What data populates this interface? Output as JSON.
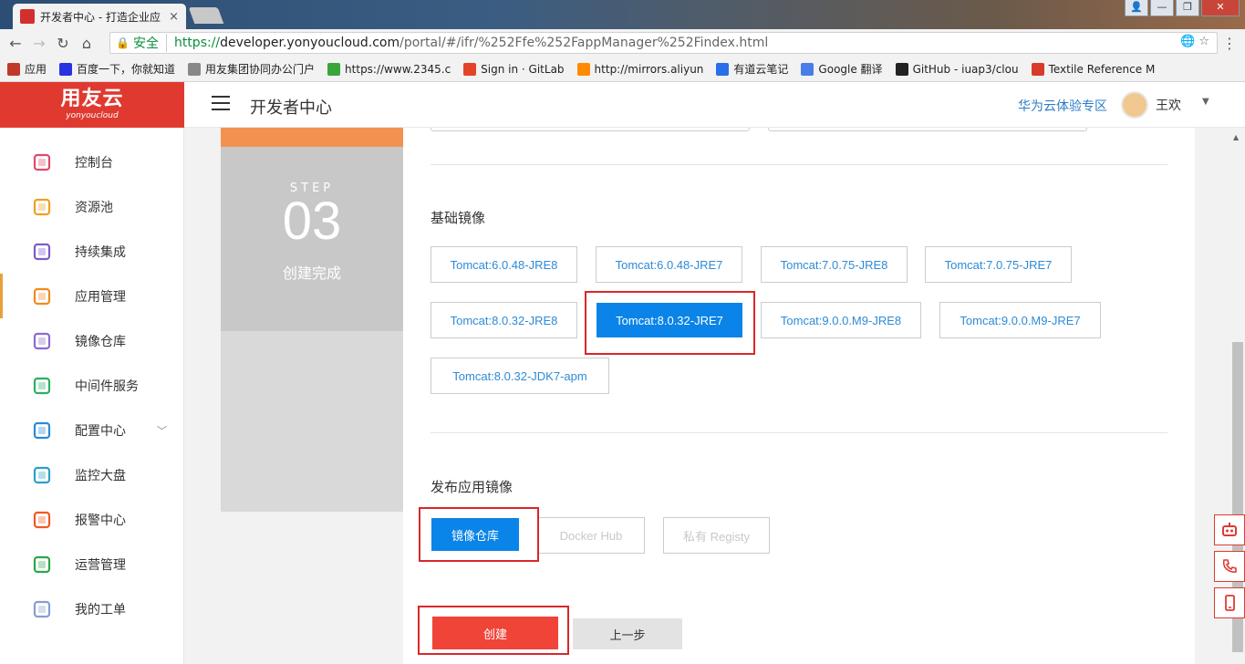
{
  "browser": {
    "tab_title": "开发者中心 - 打造企业应",
    "tab_close": "×",
    "secure_label": "安全",
    "url_scheme": "https://",
    "url_host": "developer.yonyoucloud.com",
    "url_path": "/portal/#/ifr/%252Ffe%252FappManager%252Findex.html",
    "bookmarks": [
      {
        "label": "应用",
        "color": "#c0392b"
      },
      {
        "label": "百度一下，你就知道",
        "color": "#2932e1"
      },
      {
        "label": "用友集团协同办公门户",
        "color": "#888888"
      },
      {
        "label": "https://www.2345.c",
        "color": "#3aa53a"
      },
      {
        "label": "Sign in · GitLab",
        "color": "#e24329"
      },
      {
        "label": "http://mirrors.aliyun",
        "color": "#ff8a00"
      },
      {
        "label": "有道云笔记",
        "color": "#2a6ee8"
      },
      {
        "label": "Google 翻译",
        "color": "#4a7de8"
      },
      {
        "label": "GitHub - iuap3/clou",
        "color": "#222222"
      },
      {
        "label": "Textile Reference M",
        "color": "#d83b2b"
      }
    ]
  },
  "header": {
    "logo_main": "用友云",
    "logo_sub": "yonyoucloud",
    "title": "开发者中心",
    "huawei_link": "华为云体验专区",
    "user_name": "王欢"
  },
  "sidebar": {
    "items": [
      {
        "label": "控制台",
        "icon": "dashboard-icon",
        "color": "#e04a6a"
      },
      {
        "label": "资源池",
        "icon": "inbox-icon",
        "color": "#f0a020"
      },
      {
        "label": "持续集成",
        "icon": "integration-icon",
        "color": "#7a5cc8"
      },
      {
        "label": "应用管理",
        "icon": "cubes-icon",
        "color": "#f08a20"
      },
      {
        "label": "镜像仓库",
        "icon": "warehouse-icon",
        "color": "#8a6ad0"
      },
      {
        "label": "中间件服务",
        "icon": "database-icon",
        "color": "#28b060"
      },
      {
        "label": "配置中心",
        "icon": "tools-icon",
        "color": "#2a8ad8"
      },
      {
        "label": "监控大盘",
        "icon": "monitor-icon",
        "color": "#2aa0c8"
      },
      {
        "label": "报警中心",
        "icon": "bell-icon",
        "color": "#f05a20"
      },
      {
        "label": "运营管理",
        "icon": "chart-board-icon",
        "color": "#28a848"
      },
      {
        "label": "我的工单",
        "icon": "document-icon",
        "color": "#8a9ad8"
      }
    ]
  },
  "step": {
    "label": "STEP",
    "number": "03",
    "text": "创建完成"
  },
  "base_image": {
    "title": "基础镜像",
    "options": [
      "Tomcat:6.0.48-JRE8",
      "Tomcat:6.0.48-JRE7",
      "Tomcat:7.0.75-JRE8",
      "Tomcat:7.0.75-JRE7",
      "Tomcat:8.0.32-JRE8",
      "Tomcat:8.0.32-JRE7",
      "Tomcat:9.0.0.M9-JRE8",
      "Tomcat:9.0.0.M9-JRE7",
      "Tomcat:8.0.32-JDK7-apm"
    ],
    "selected": "Tomcat:8.0.32-JRE7"
  },
  "publish": {
    "title": "发布应用镜像",
    "options": [
      "镜像仓库",
      "Docker Hub",
      "私有 Registy"
    ],
    "selected": "镜像仓库"
  },
  "actions": {
    "create": "创建",
    "prev": "上一步"
  }
}
